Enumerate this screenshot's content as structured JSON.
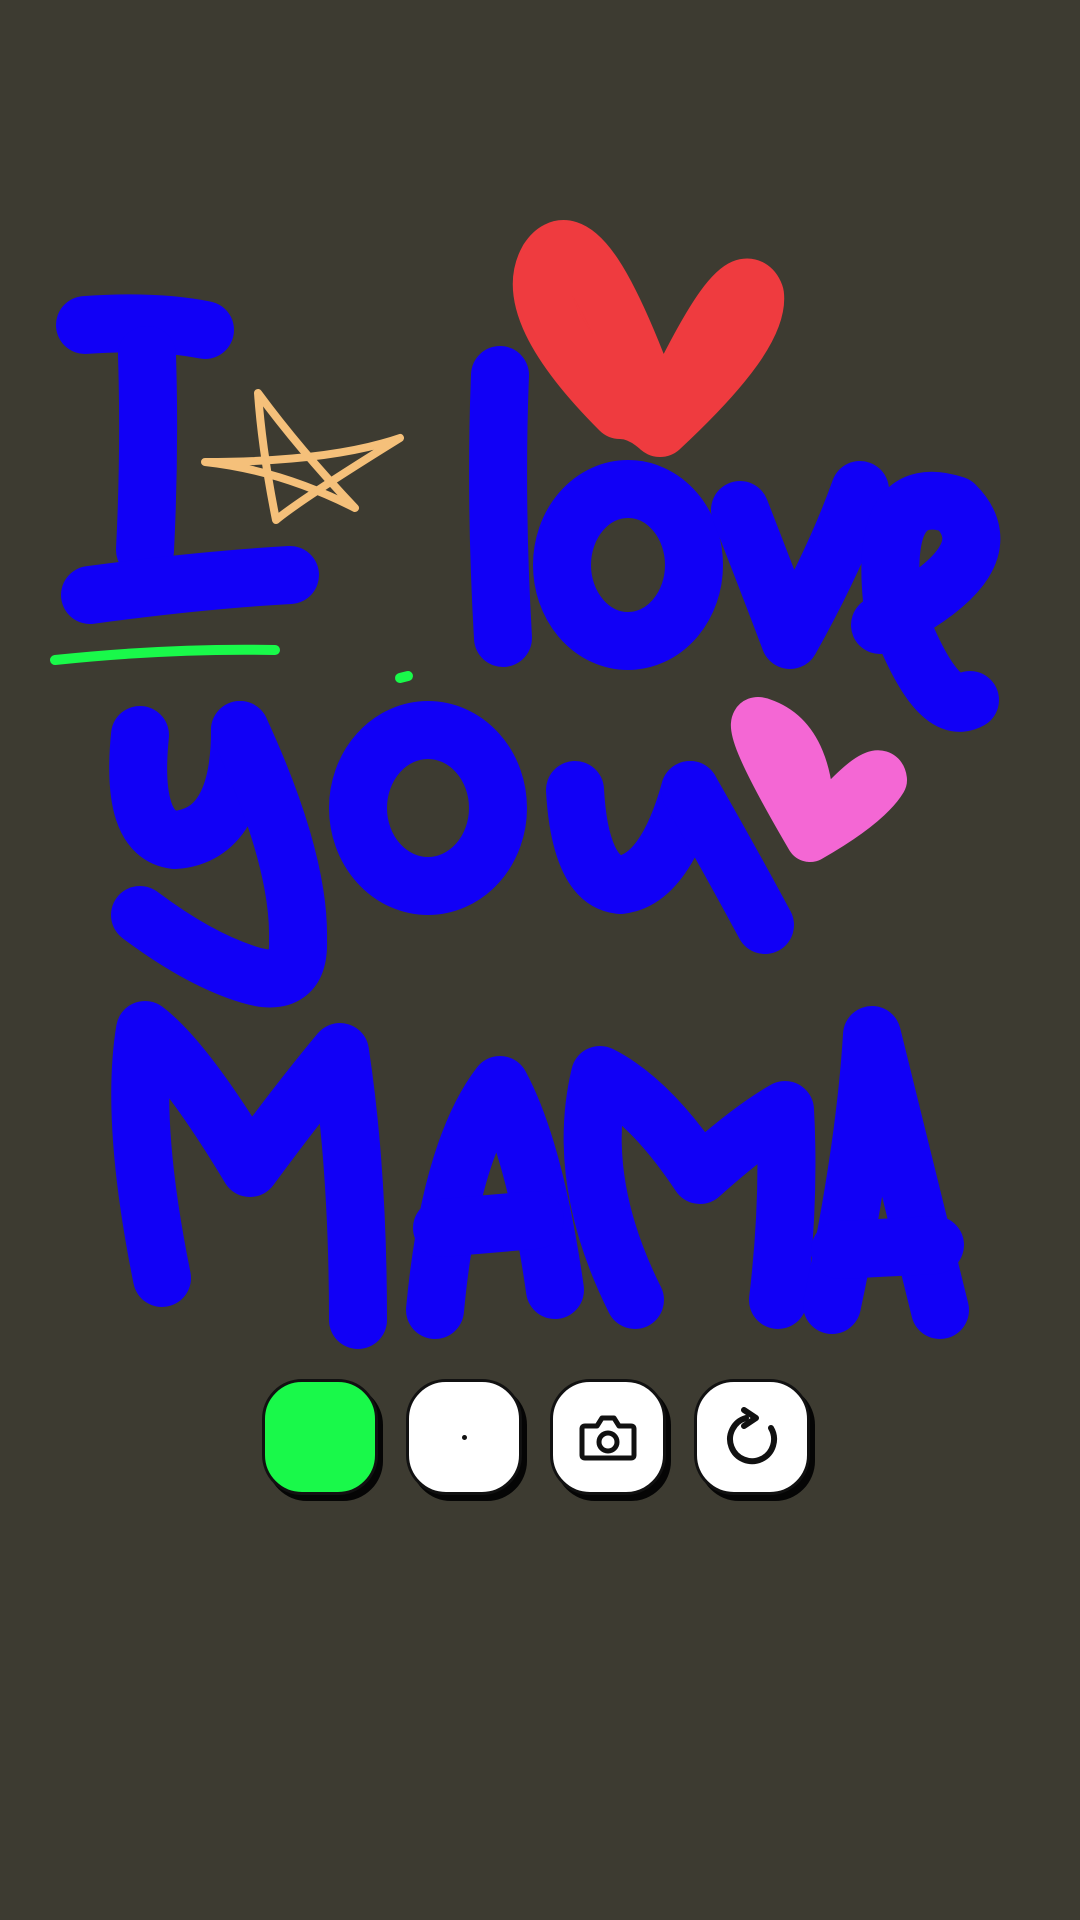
{
  "colors": {
    "background": "#3d3b31",
    "selected_color": "#19f94a",
    "blue_ink": "#1100f6",
    "red_ink": "#ef3b3f",
    "pink_ink": "#f467d4",
    "tan_ink": "#f5c07a",
    "green_ink": "#19f94a",
    "button_fill": "#ffffff"
  },
  "toolbar": {
    "color_swatch": {
      "icon": "color-swatch",
      "selected": "green"
    },
    "brush_size": {
      "icon": "brush-size-dot",
      "size": "small"
    },
    "screenshot": {
      "icon": "camera-icon"
    },
    "undo": {
      "icon": "undo-icon"
    }
  }
}
